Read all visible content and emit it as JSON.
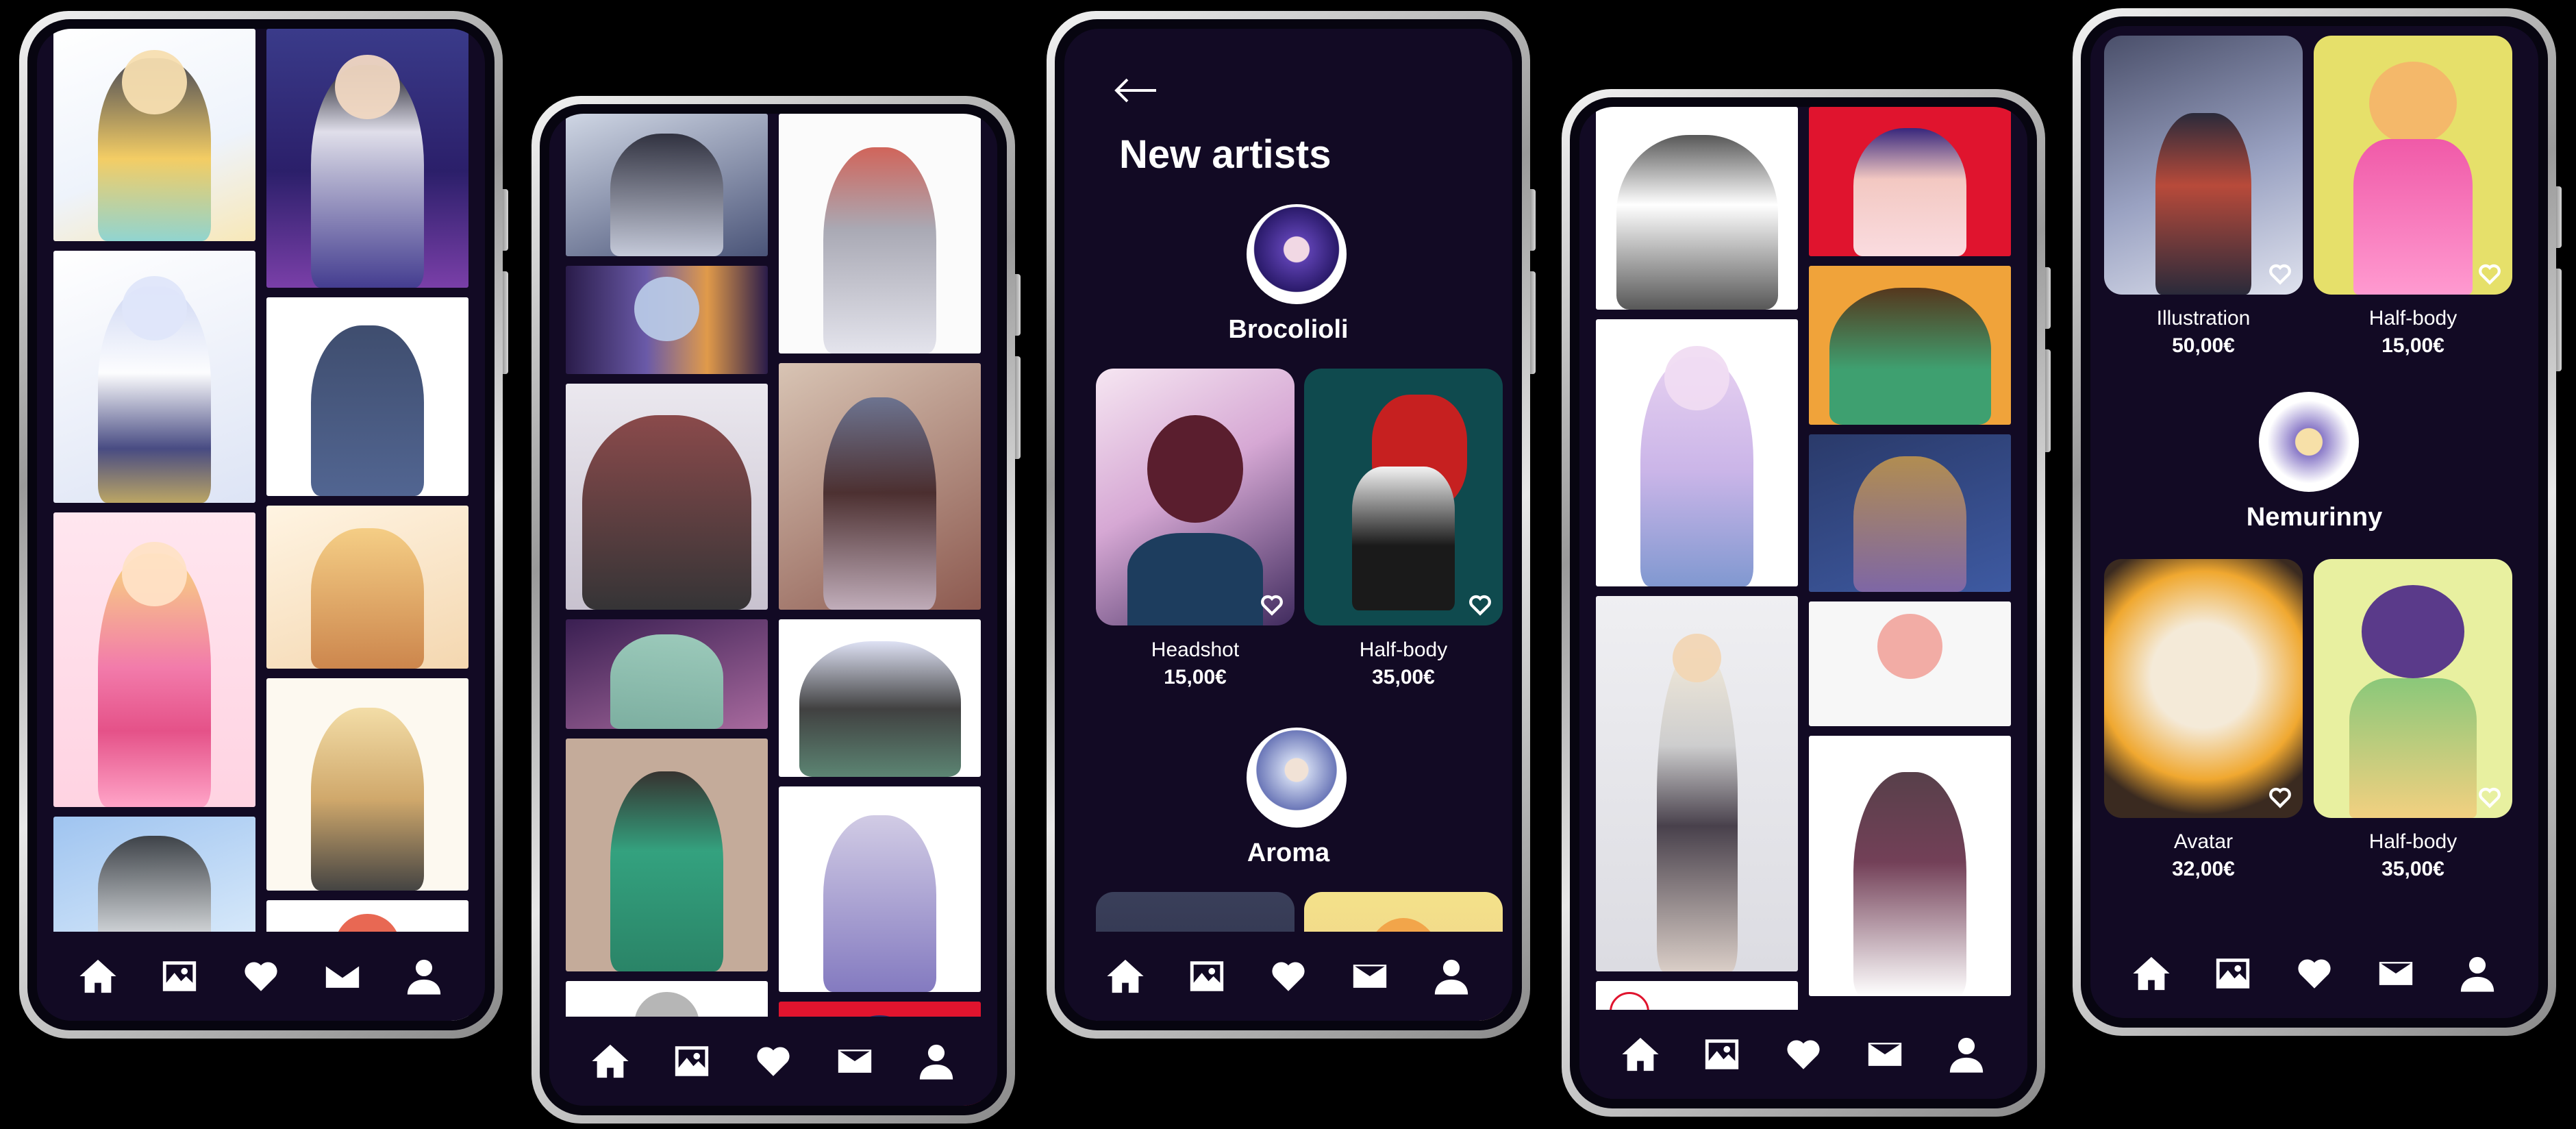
{
  "colors": {
    "background": "#000000",
    "screen": "#120a24",
    "text": "#ffffff",
    "accent_red": "#e0142e"
  },
  "navbar": {
    "icons": [
      "home-icon",
      "gallery-icon",
      "heart-icon",
      "mail-icon",
      "profile-icon"
    ]
  },
  "screen3": {
    "back_icon": "arrow-left-icon",
    "title": "New artists",
    "artists": [
      {
        "name": "Brocolioli",
        "commissions": [
          {
            "label": "Headshot",
            "price": "15,00€"
          },
          {
            "label": "Half-body",
            "price": "35,00€"
          }
        ]
      },
      {
        "name": "Aroma",
        "commissions": []
      }
    ]
  },
  "screen5": {
    "top_commissions": [
      {
        "label": "Illustration",
        "price": "50,00€"
      },
      {
        "label": "Half-body",
        "price": "15,00€"
      }
    ],
    "artist": {
      "name": "Nemurinny",
      "commissions": [
        {
          "label": "Avatar",
          "price": "32,00€"
        },
        {
          "label": "Half-body",
          "price": "35,00€"
        }
      ]
    }
  }
}
